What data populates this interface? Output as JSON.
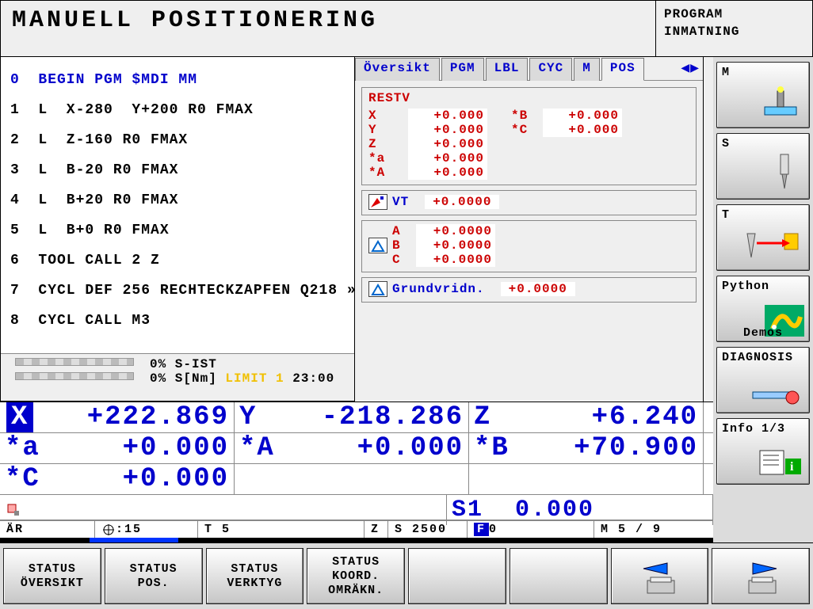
{
  "header": {
    "title": "MANUELL POSITIONERING",
    "mode1": "PROGRAM",
    "mode2": "INMATNING"
  },
  "program": [
    {
      "n": "0",
      "t": "BEGIN PGM $MDI MM",
      "hl": true
    },
    {
      "n": "1",
      "t": "L  X-280  Y+200 R0 FMAX"
    },
    {
      "n": "2",
      "t": "L  Z-160 R0 FMAX"
    },
    {
      "n": "3",
      "t": "L  B-20 R0 FMAX"
    },
    {
      "n": "4",
      "t": "L  B+20 R0 FMAX"
    },
    {
      "n": "5",
      "t": "L  B+0 R0 FMAX"
    },
    {
      "n": "6",
      "t": "TOOL CALL 2 Z"
    },
    {
      "n": "7",
      "t": "CYCL DEF 256 RECHTECKZAPFEN Q218 »"
    },
    {
      "n": "8",
      "t": "CYCL CALL M3"
    }
  ],
  "status": {
    "s_ist": "0% S-IST",
    "s_nm": "0% S[Nm]",
    "limit": "LIMIT 1",
    "time": "23:00"
  },
  "tabs": [
    "Översikt",
    "PGM",
    "LBL",
    "CYC",
    "M",
    "POS"
  ],
  "active_tab": "POS",
  "restv": {
    "title": "RESTV",
    "left": [
      {
        "k": "X",
        "v": "+0.000"
      },
      {
        "k": "Y",
        "v": "+0.000"
      },
      {
        "k": "Z",
        "v": "+0.000"
      },
      {
        "k": "*a",
        "v": "+0.000"
      },
      {
        "k": "*A",
        "v": "+0.000"
      }
    ],
    "right": [
      {
        "k": "*B",
        "v": "+0.000"
      },
      {
        "k": "*C",
        "v": "+0.000"
      }
    ]
  },
  "vt": {
    "label": "VT",
    "value": "+0.0000"
  },
  "abc": [
    {
      "k": "A",
      "v": "+0.0000"
    },
    {
      "k": "B",
      "v": "+0.0000"
    },
    {
      "k": "C",
      "v": "+0.0000"
    }
  ],
  "grund": {
    "label": "Grundvridn.",
    "value": "+0.0000"
  },
  "dro": {
    "row1": [
      {
        "a": "X",
        "v": "+222.869",
        "inv": true
      },
      {
        "a": "Y",
        "v": "-218.286"
      },
      {
        "a": "Z",
        "v": "+6.240"
      }
    ],
    "row2": [
      {
        "a": "*a",
        "v": "+0.000"
      },
      {
        "a": "*A",
        "v": "+0.000"
      },
      {
        "a": "*B",
        "v": "+70.900"
      }
    ],
    "row3": [
      {
        "a": "*C",
        "v": "+0.000"
      },
      {
        "a": "",
        "v": ""
      },
      {
        "a": "",
        "v": ""
      }
    ],
    "spindle": "S1  0.000"
  },
  "info_bar": {
    "mode": "ÄR",
    "dat": ":15",
    "tool": "T 5",
    "z": "Z",
    "s": "S 2500",
    "f": "0",
    "m": "M 5 / 9"
  },
  "vkeys": [
    {
      "l": "M"
    },
    {
      "l": "S"
    },
    {
      "l": "T"
    },
    {
      "l": "Python",
      "sub": "Demos"
    },
    {
      "l": "DIAGNOSIS"
    },
    {
      "l": "Info 1/3"
    }
  ],
  "softkeys": [
    "STATUS\nÖVERSIKT",
    "STATUS\nPOS.",
    "STATUS\nVERKTYG",
    "STATUS\nKOORD.\nOMRÄKN.",
    "",
    "",
    "←",
    "→"
  ]
}
